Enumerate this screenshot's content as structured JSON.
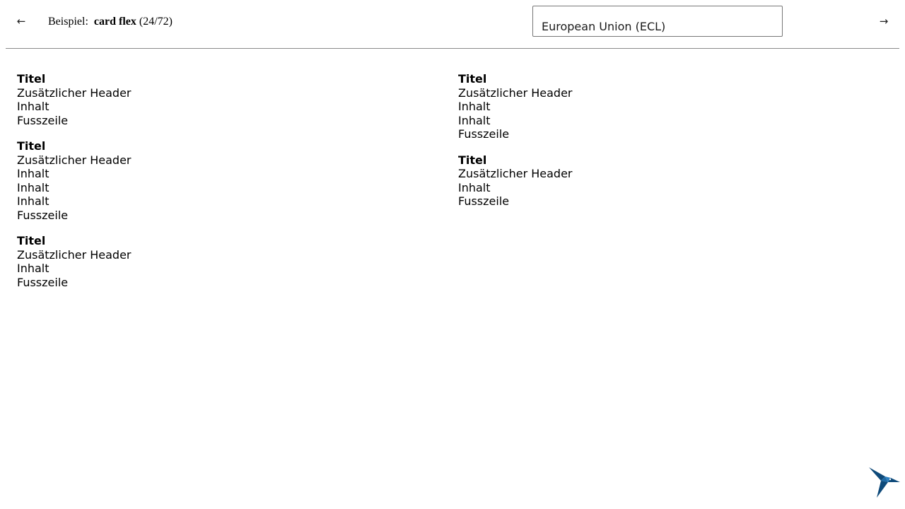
{
  "header": {
    "prev_arrow": "←",
    "next_arrow": "→",
    "example_prefix": "Beispiel:",
    "example_name": "card flex",
    "example_counter": "(24/72)",
    "theme_select_value": "European Union (ECL)"
  },
  "columns": [
    {
      "cards": [
        {
          "title": "Titel",
          "header": "Zusätzlicher Header",
          "contents": [
            "Inhalt"
          ],
          "footer": "Fusszeile"
        },
        {
          "title": "Titel",
          "header": "Zusätzlicher Header",
          "contents": [
            "Inhalt",
            "Inhalt",
            "Inhalt"
          ],
          "footer": "Fusszeile"
        },
        {
          "title": "Titel",
          "header": "Zusätzlicher Header",
          "contents": [
            "Inhalt"
          ],
          "footer": "Fusszeile"
        }
      ]
    },
    {
      "cards": [
        {
          "title": "Titel",
          "header": "Zusätzlicher Header",
          "contents": [
            "Inhalt",
            "Inhalt"
          ],
          "footer": "Fusszeile"
        },
        {
          "title": "Titel",
          "header": "Zusätzlicher Header",
          "contents": [
            "Inhalt"
          ],
          "footer": "Fusszeile"
        }
      ]
    }
  ],
  "logo": {
    "icon": "hummingbird-logo-icon",
    "color": "#0e4a7a"
  }
}
